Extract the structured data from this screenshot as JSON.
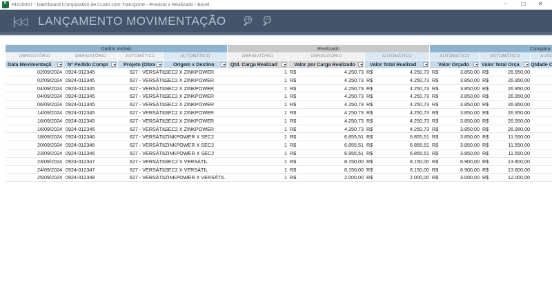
{
  "window": {
    "title": "PDD0007 - Dashboard Comparativo de Custo com Transporte - Previsto x Realizado - Excel",
    "controls": [
      "–",
      "▢",
      "✕"
    ]
  },
  "ribbon": {
    "title": "LANÇAMENTO MOVIMENTAÇÃO",
    "skip_icon": "skip-back-icon",
    "zoom_in_icon": "zoom-in-icon",
    "zoom_out_icon": "zoom-out-icon"
  },
  "colors": {
    "ribbon_bg": "#44546a",
    "group_dados": "#8db3d0",
    "group_realizado": "#c9c9c9",
    "group_compar": "#8db3d0",
    "sub_auto": "#dbe9f5",
    "sub_obrig": "#f2f2f2",
    "header_blue": "#c5daeb",
    "header_gray": "#d9d9d9"
  },
  "groups": {
    "dados": "Dados iniciais",
    "realizado": "Realizado",
    "compar": "Compara"
  },
  "subheaders": {
    "s1": "OBRIGATÓRIO",
    "s2": "OBRIGATÓRIO",
    "s3": "AUTOMÁTICO",
    "s4": "AUTOMÁTICO",
    "s5": "OBRIGATÓRIO",
    "s6": "OBRIGATÓRIO",
    "s7": "AUTOMÁTICO",
    "s8": "AUTOMÁTICO",
    "s9": "AUTOMÁTICO",
    "s10": "AUTO"
  },
  "columns": {
    "data": "Data Movimentaçã",
    "pedido": "Nº Pedido Compr",
    "projeto": "Projeto (Obra",
    "origem": "Origem x Destino",
    "qtd": "Qtd. Carga Realizad",
    "valor_carga": "Valor por Carga Realizado",
    "valor_total": "Valor Total Realizad",
    "valor_orcado": "Valor Orçado",
    "valor_total_orcado": "Valor Total Orça",
    "qtde": "Qtdade C"
  },
  "currency": "R$",
  "rows": [
    {
      "data": "02/09/2024",
      "pedido": "0924-012345",
      "projeto": "627 - VERSÁTIL",
      "origem": "SEC2 X ZINKPOWER",
      "qtd": "1",
      "valor_carga": "4.250,73",
      "valor_total": "4.250,73",
      "valor_orcado": "3.850,00",
      "valor_total_orcado": "26.950,00"
    },
    {
      "data": "02/09/2024",
      "pedido": "0924-012345",
      "projeto": "627 - VERSÁTIL",
      "origem": "SEC2 X ZINKPOWER",
      "qtd": "1",
      "valor_carga": "4.250,73",
      "valor_total": "4.250,73",
      "valor_orcado": "3.850,00",
      "valor_total_orcado": "26.950,00"
    },
    {
      "data": "04/09/2024",
      "pedido": "0924-012345",
      "projeto": "627 - VERSÁTIL",
      "origem": "SEC2 X ZINKPOWER",
      "qtd": "1",
      "valor_carga": "4.250,73",
      "valor_total": "4.250,73",
      "valor_orcado": "3.850,00",
      "valor_total_orcado": "26.950,00"
    },
    {
      "data": "04/09/2024",
      "pedido": "0924-012345",
      "projeto": "627 - VERSÁTIL",
      "origem": "SEC2 X ZINKPOWER",
      "qtd": "1",
      "valor_carga": "4.250,73",
      "valor_total": "4.250,73",
      "valor_orcado": "3.850,00",
      "valor_total_orcado": "26.950,00"
    },
    {
      "data": "06/09/2024",
      "pedido": "0924-012345",
      "projeto": "627 - VERSÁTIL",
      "origem": "SEC2 X ZINKPOWER",
      "qtd": "1",
      "valor_carga": "4.250,73",
      "valor_total": "4.250,73",
      "valor_orcado": "3.850,00",
      "valor_total_orcado": "26.950,00"
    },
    {
      "data": "14/09/2024",
      "pedido": "0924-012345",
      "projeto": "627 - VERSÁTIL",
      "origem": "SEC2 X ZINKPOWER",
      "qtd": "1",
      "valor_carga": "4.250,73",
      "valor_total": "4.250,73",
      "valor_orcado": "3.850,00",
      "valor_total_orcado": "26.950,00"
    },
    {
      "data": "16/09/2024",
      "pedido": "0924-012345",
      "projeto": "627 - VERSÁTIL",
      "origem": "SEC2 X ZINKPOWER",
      "qtd": "1",
      "valor_carga": "4.250,73",
      "valor_total": "4.250,73",
      "valor_orcado": "3.850,00",
      "valor_total_orcado": "26.950,00"
    },
    {
      "data": "16/09/2024",
      "pedido": "0924-012345",
      "projeto": "627 - VERSÁTIL",
      "origem": "SEC2 X ZINKPOWER",
      "qtd": "1",
      "valor_carga": "4.250,73",
      "valor_total": "4.250,73",
      "valor_orcado": "3.850,00",
      "valor_total_orcado": "26.950,00"
    },
    {
      "data": "18/09/2024",
      "pedido": "0924-012346",
      "projeto": "627 - VERSÁTIL",
      "origem": "ZINKPOWER X SEC2",
      "qtd": "1",
      "valor_carga": "6.855,51",
      "valor_total": "6.855,51",
      "valor_orcado": "3.850,00",
      "valor_total_orcado": "11.550,00"
    },
    {
      "data": "20/09/2024",
      "pedido": "0924-012346",
      "projeto": "627 - VERSÁTIL",
      "origem": "ZINKPOWER X SEC2",
      "qtd": "1",
      "valor_carga": "6.855,51",
      "valor_total": "6.855,51",
      "valor_orcado": "3.850,00",
      "valor_total_orcado": "11.550,00"
    },
    {
      "data": "23/09/2024",
      "pedido": "0924-012346",
      "projeto": "627 - VERSÁTIL",
      "origem": "ZINKPOWER X SEC2",
      "qtd": "1",
      "valor_carga": "6.855,51",
      "valor_total": "6.855,51",
      "valor_orcado": "3.850,00",
      "valor_total_orcado": "11.550,00"
    },
    {
      "data": "23/09/2024",
      "pedido": "0924-012347",
      "projeto": "627 - VERSÁTIL",
      "origem": "SEC2 X VERSÁTIL",
      "qtd": "1",
      "valor_carga": "8.150,00",
      "valor_total": "8.150,00",
      "valor_orcado": "6.900,00",
      "valor_total_orcado": "13.800,00"
    },
    {
      "data": "24/09/2024",
      "pedido": "0924-012347",
      "projeto": "627 - VERSÁTIL",
      "origem": "SEC2 X VERSÁTIL",
      "qtd": "1",
      "valor_carga": "8.150,00",
      "valor_total": "8.150,00",
      "valor_orcado": "6.900,00",
      "valor_total_orcado": "13.800,00"
    },
    {
      "data": "25/09/2024",
      "pedido": "0924-012348",
      "projeto": "627 - VERSÁTIL",
      "origem": "ZINKPOWER X VERSÁTIL",
      "qtd": "1",
      "valor_carga": "2.000,00",
      "valor_total": "2.000,00",
      "valor_orcado": "3.000,00",
      "valor_total_orcado": "12.000,00"
    }
  ]
}
